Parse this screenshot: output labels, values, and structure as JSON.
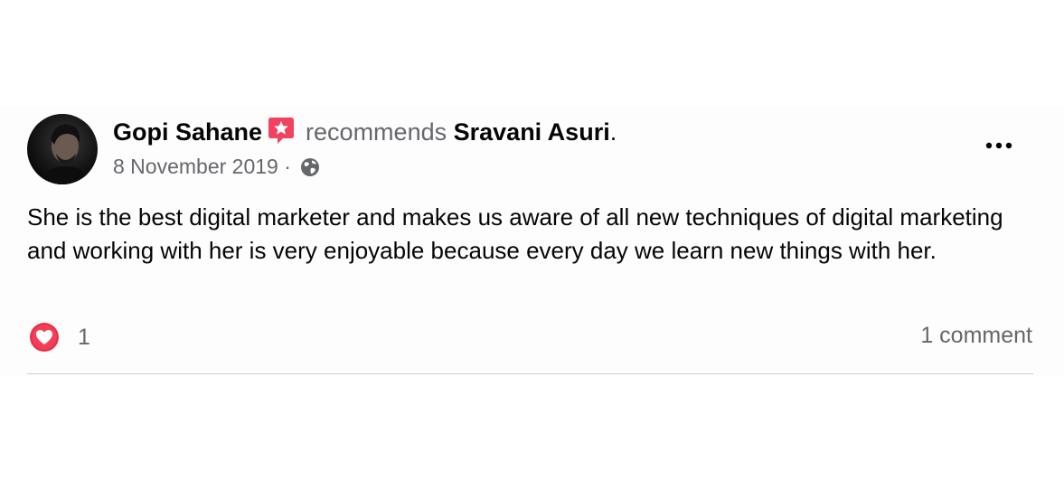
{
  "post": {
    "author": "Gopi Sahane",
    "verb": "recommends",
    "target": "Sravani Asuri",
    "target_suffix": ".",
    "date": "8 November 2019",
    "separator": "·",
    "audience_icon": "globe-icon",
    "badge_icon": "recommendation-star-icon",
    "more_icon": "more-options-icon",
    "text": "She is the best digital marketer and makes us aware of all new techniques of digital marketing and working with her is very enjoyable because every day we learn new things with her.",
    "reaction_icon": "heart-reaction-icon",
    "reaction_count": "1",
    "comment_count": "1 comment"
  },
  "colors": {
    "badge": "#f3425f",
    "heart": "#f33e58",
    "secondary_text": "#65676b",
    "divider": "#cfd0d3"
  }
}
